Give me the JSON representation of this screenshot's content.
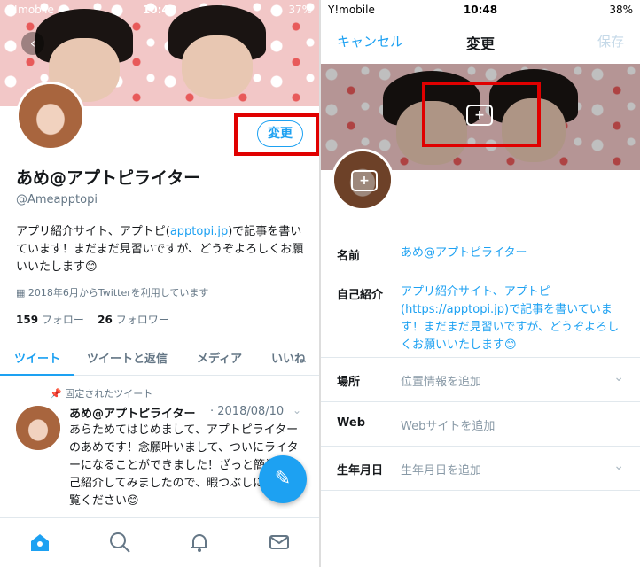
{
  "left": {
    "status": {
      "carrier": "Y!mobile",
      "time": "10:48",
      "battery": "37%"
    },
    "profile": {
      "edit_label": "変更",
      "name": "あめ@アプトピライター",
      "handle": "@Ameapptopi",
      "bio_prefix": "アプリ紹介サイト、アプトピ(",
      "bio_link": "apptopi.jp",
      "bio_suffix": ")で記事を書いています！まだまだ見習いですが、どうぞよろしくお願いいたします😊",
      "joined": "2018年6月からTwitterを利用しています",
      "following_count": "159",
      "following_label": "フォロー",
      "followers_count": "26",
      "followers_label": "フォロワー"
    },
    "tabs": [
      "ツイート",
      "ツイートと返信",
      "メディア",
      "いいね"
    ],
    "tweet": {
      "pinned_label": "固定されたツイート",
      "author": "あめ@アプトピライター",
      "date": "· 2018/08/10",
      "text": "あらためてはじめまして、アプトピライターのあめです！念願叶いまして、ついにライターになることができました！ざっと簡単に自己紹介してみましたので、暇つぶしにでもご覧ください😊"
    },
    "nav": [
      "home-icon",
      "search-icon",
      "bell-icon",
      "mail-icon"
    ]
  },
  "right": {
    "status": {
      "carrier": "Y!mobile",
      "time": "10:48",
      "battery": "38%"
    },
    "header": {
      "cancel": "キャンセル",
      "title": "変更",
      "save": "保存"
    },
    "form": {
      "name_label": "名前",
      "name_value": "あめ@アプトピライター",
      "bio_label": "自己紹介",
      "bio_value": "アプリ紹介サイト、アプトピ(https://apptopi.jp)で記事を書いています！まだまだ見習いですが、どうぞよろしくお願いいたします😊",
      "location_label": "場所",
      "location_placeholder": "位置情報を追加",
      "web_label": "Web",
      "web_placeholder": "Webサイトを追加",
      "birthday_label": "生年月日",
      "birthday_placeholder": "生年月日を追加"
    }
  },
  "colors": {
    "accent": "#1da1f2",
    "highlight": "#e00000"
  }
}
